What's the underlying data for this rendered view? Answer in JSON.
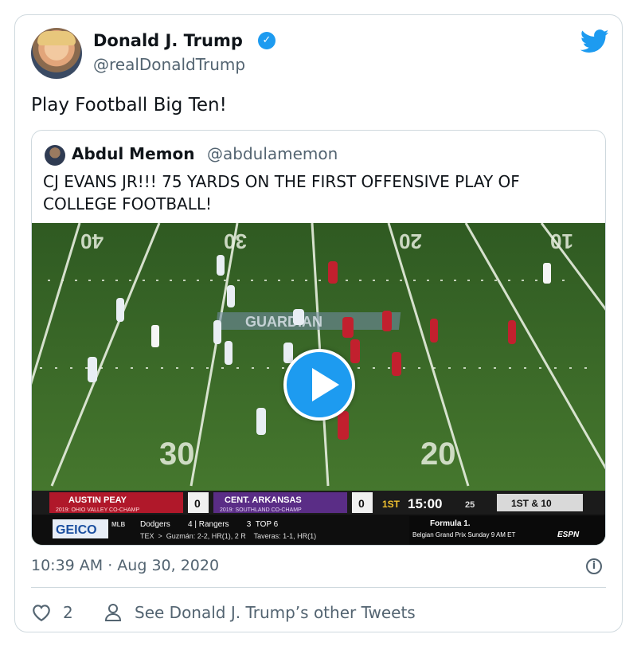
{
  "tweet": {
    "author_name": "Donald J. Trump",
    "author_handle": "@realDonaldTrump",
    "verified_glyph": "✓",
    "text": "Play Football Big Ten!",
    "timestamp": "10:39 AM · Aug 30, 2020",
    "like_count": "2",
    "other_tweets_label": "See Donald J. Trump’s other Tweets",
    "info_glyph": "i"
  },
  "quote": {
    "author_name": "Abdul Memon",
    "author_handle": "@abdulamemon",
    "text": "CJ EVANS JR!!! 75 YARDS ON THE FIRST OFFENSIVE PLAY OF COLLEGE FOOTBALL!"
  },
  "video": {
    "field_numbers": {
      "n40": "40",
      "n30": "30",
      "n20a": "20",
      "n10": "10",
      "n30b": "30",
      "n20b": "20"
    },
    "field_logo": "GUARDIAN",
    "scoreboard": {
      "team1": "AUSTIN PEAY",
      "team1_sub": "2019: OHIO VALLEY CO-CHAMP",
      "team1_score": "0",
      "team2": "CENT. ARKANSAS",
      "team2_sub": "2019: SOUTHLAND CO-CHAMP",
      "team2_score": "0",
      "quarter": "1ST",
      "clock": "15:00",
      "play_clock": "25",
      "down": "1ST & 10"
    },
    "ticker": {
      "sponsor": "GEICO",
      "league": "MLB",
      "row1": "Dodgers        4 | Rangers        3  TOP 6",
      "row2": "TEX  >  Guzmán: 2-2, HR(1), 2 R    Taveras: 1-1, HR(1)",
      "promo1": "Formula 1.",
      "promo2": "Belgian Grand Prix Sunday 9 AM ET",
      "network": "ESPN"
    }
  },
  "colors": {
    "accent": "#1d9bf0",
    "text_secondary": "#536471",
    "border": "#cfd9de",
    "field": "#3d6b2a",
    "team1": "#b0182a",
    "team2": "#5a2d86"
  },
  "icons": [
    "twitter-bird-icon",
    "verified-badge-icon",
    "play-icon",
    "info-icon",
    "heart-icon",
    "person-icon"
  ]
}
